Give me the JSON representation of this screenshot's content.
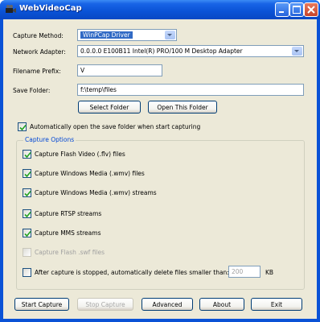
{
  "window": {
    "title": "WebVideoCap"
  },
  "form": {
    "capture_method_label": "Capture Method:",
    "capture_method_value": "WinPCap Driver",
    "network_adapter_label": "Network Adapter:",
    "network_adapter_value": "0.0.0.0   E100B11 Intel(R) PRO/100 M Desktop Adapter",
    "filename_prefix_label": "Filename Prefix:",
    "filename_prefix_value": "V",
    "save_folder_label": "Save Folder:",
    "save_folder_value": "f:\\temp\\files",
    "select_folder_button": "Select Folder",
    "open_folder_button": "Open This Folder",
    "auto_open_label": "Automatically open the save folder when start capturing",
    "auto_open_checked": true
  },
  "capture_options": {
    "legend": "Capture Options",
    "items": [
      {
        "label": "Capture Flash Video (.flv) files",
        "checked": true,
        "enabled": true
      },
      {
        "label": "Capture Windows Media (.wmv) files",
        "checked": true,
        "enabled": true
      },
      {
        "label": "Capture Windows Media (.wmv) streams",
        "checked": true,
        "enabled": true
      },
      {
        "label": "Capture RTSP streams",
        "checked": true,
        "enabled": true
      },
      {
        "label": "Capture MMS streams",
        "checked": true,
        "enabled": true
      },
      {
        "label": "Capture Flash .swf files",
        "checked": false,
        "enabled": true
      }
    ],
    "auto_delete_label": "After capture is stopped, automatically delete files smaller than:",
    "auto_delete_checked": false,
    "auto_delete_size": "200",
    "auto_delete_unit": "KB"
  },
  "buttons": {
    "start_capture": "Start Capture",
    "stop_capture": "Stop Capture",
    "advanced": "Advanced",
    "about": "About",
    "exit": "Exit"
  },
  "colors": {
    "title_bar": "#0a52d6",
    "dialog_bg": "#ece9d8",
    "group_legend": "#0046d5",
    "selection": "#316ac5"
  }
}
